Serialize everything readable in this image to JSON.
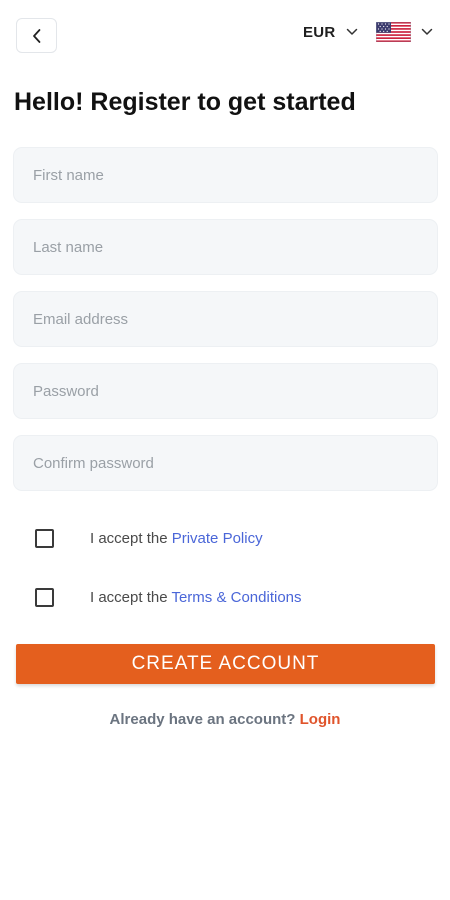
{
  "header": {
    "currency": "EUR",
    "language_flag": "us-flag-icon"
  },
  "title": "Hello! Register to get started",
  "form": {
    "first_name": {
      "placeholder": "First name",
      "value": ""
    },
    "last_name": {
      "placeholder": "Last name",
      "value": ""
    },
    "email": {
      "placeholder": "Email address",
      "value": ""
    },
    "password": {
      "placeholder": "Password",
      "value": ""
    },
    "confirm_password": {
      "placeholder": "Confirm password",
      "value": ""
    }
  },
  "consents": {
    "privacy": {
      "prefix": "I accept the ",
      "link": "Private Policy",
      "checked": false
    },
    "terms": {
      "prefix": "I accept the ",
      "link": "Terms & Conditions",
      "checked": false
    }
  },
  "create_button": "CREATE ACCOUNT",
  "footer": {
    "question": "Already have an account? ",
    "login_link": "Login"
  },
  "colors": {
    "accent": "#e45f1e",
    "link": "#4a66d8",
    "login_link": "#e0542b",
    "field_bg": "#f5f7f9"
  }
}
